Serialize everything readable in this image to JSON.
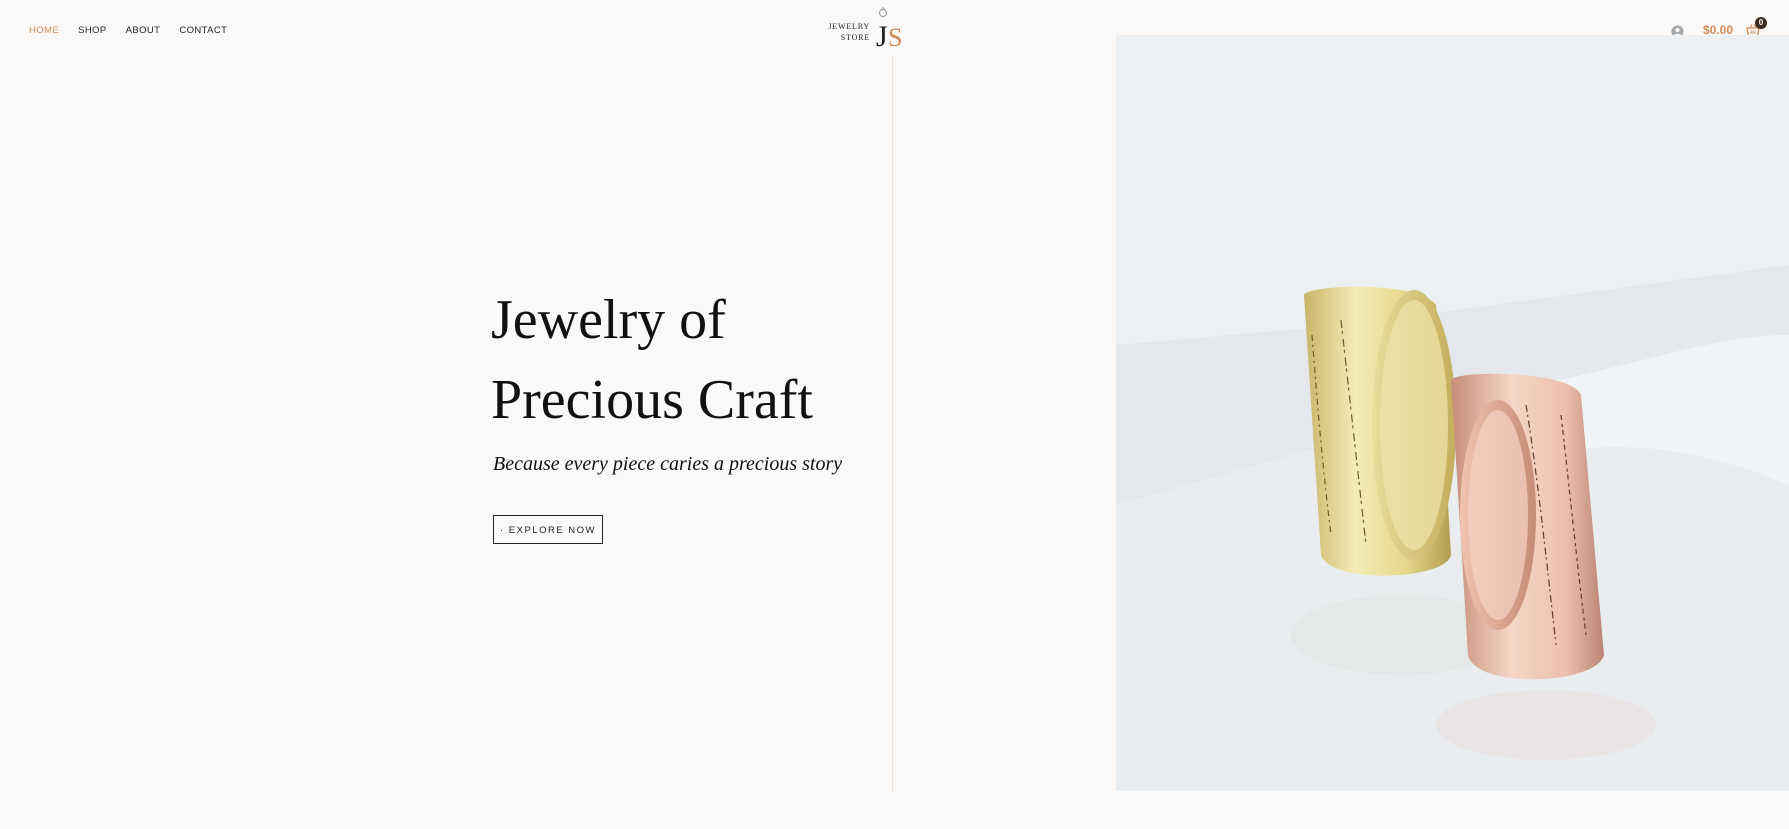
{
  "nav": {
    "items": [
      {
        "label": "HOME",
        "active": true
      },
      {
        "label": "SHOP",
        "active": false
      },
      {
        "label": "ABOUT",
        "active": false
      },
      {
        "label": "CONTACT",
        "active": false
      }
    ]
  },
  "logo": {
    "line1": "JEWELRY",
    "line2": "STORE",
    "monogram_j": "J",
    "monogram_s": "S"
  },
  "header": {
    "cart_total": "$0.00",
    "cart_count": "0",
    "user_icon": "user-circle-icon",
    "cart_icon": "shopping-basket-icon"
  },
  "hero": {
    "title_line1": "Jewelry of",
    "title_line2": "Precious Craft",
    "subtitle": "Because every piece caries a precious story",
    "cta_label": "· EXPLORE NOW",
    "image_alt": "Gold and rose gold engraved wedding rings"
  },
  "colors": {
    "accent": "#d38a57",
    "background": "#faf9f8",
    "text": "#111111"
  }
}
